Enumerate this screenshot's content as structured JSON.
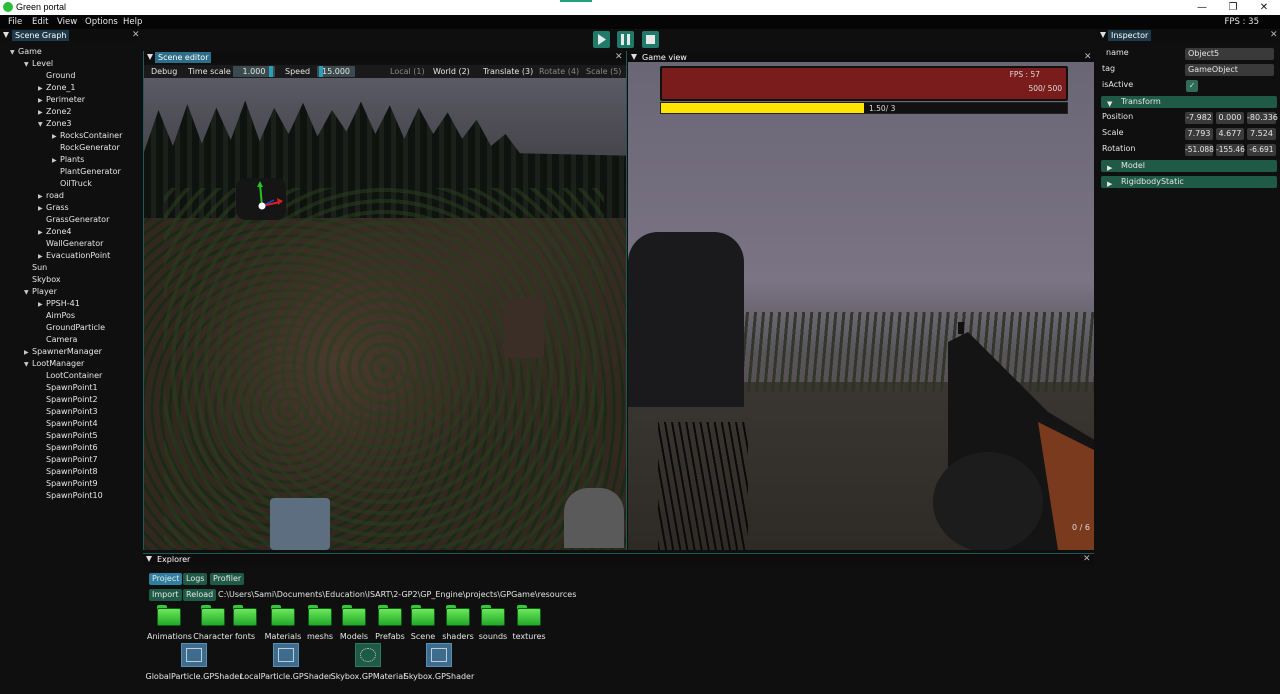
{
  "window": {
    "title": "Green portal",
    "minimize_glyph": "—",
    "restore_glyph": "❐",
    "close_glyph": "✕"
  },
  "menu": {
    "items": [
      "File",
      "Edit",
      "View",
      "Options",
      "Help"
    ],
    "fps": "FPS : 35"
  },
  "scene_graph": {
    "title": "Scene Graph",
    "close_glyph": "✕",
    "nodes": [
      {
        "label": "Game",
        "depth": 0,
        "arrow": "down"
      },
      {
        "label": "Level",
        "depth": 1,
        "arrow": "down"
      },
      {
        "label": "Ground",
        "depth": 2,
        "arrow": "none"
      },
      {
        "label": "Zone_1",
        "depth": 2,
        "arrow": "right"
      },
      {
        "label": "Perimeter",
        "depth": 2,
        "arrow": "right"
      },
      {
        "label": "Zone2",
        "depth": 2,
        "arrow": "right"
      },
      {
        "label": "Zone3",
        "depth": 2,
        "arrow": "down"
      },
      {
        "label": "RocksContainer",
        "depth": 3,
        "arrow": "right"
      },
      {
        "label": "RockGenerator",
        "depth": 3,
        "arrow": "none"
      },
      {
        "label": "Plants",
        "depth": 3,
        "arrow": "right"
      },
      {
        "label": "PlantGenerator",
        "depth": 3,
        "arrow": "none"
      },
      {
        "label": "OilTruck",
        "depth": 3,
        "arrow": "none"
      },
      {
        "label": "road",
        "depth": 2,
        "arrow": "right"
      },
      {
        "label": "Grass",
        "depth": 2,
        "arrow": "right"
      },
      {
        "label": "GrassGenerator",
        "depth": 2,
        "arrow": "none"
      },
      {
        "label": "Zone4",
        "depth": 2,
        "arrow": "right"
      },
      {
        "label": "WallGenerator",
        "depth": 2,
        "arrow": "none"
      },
      {
        "label": "EvacuationPoint",
        "depth": 2,
        "arrow": "right"
      },
      {
        "label": "Sun",
        "depth": 1,
        "arrow": "none"
      },
      {
        "label": "Skybox",
        "depth": 1,
        "arrow": "none"
      },
      {
        "label": "Player",
        "depth": 1,
        "arrow": "down"
      },
      {
        "label": "PPSH-41",
        "depth": 2,
        "arrow": "right"
      },
      {
        "label": "AimPos",
        "depth": 2,
        "arrow": "none"
      },
      {
        "label": "GroundParticle",
        "depth": 2,
        "arrow": "none"
      },
      {
        "label": "Camera",
        "depth": 2,
        "arrow": "none"
      },
      {
        "label": "SpawnerManager",
        "depth": 1,
        "arrow": "right"
      },
      {
        "label": "LootManager",
        "depth": 1,
        "arrow": "down"
      },
      {
        "label": "LootContainer",
        "depth": 2,
        "arrow": "none"
      },
      {
        "label": "SpawnPoint1",
        "depth": 2,
        "arrow": "none"
      },
      {
        "label": "SpawnPoint2",
        "depth": 2,
        "arrow": "none"
      },
      {
        "label": "SpawnPoint3",
        "depth": 2,
        "arrow": "none"
      },
      {
        "label": "SpawnPoint4",
        "depth": 2,
        "arrow": "none"
      },
      {
        "label": "SpawnPoint5",
        "depth": 2,
        "arrow": "none"
      },
      {
        "label": "SpawnPoint6",
        "depth": 2,
        "arrow": "none"
      },
      {
        "label": "SpawnPoint7",
        "depth": 2,
        "arrow": "none"
      },
      {
        "label": "SpawnPoint8",
        "depth": 2,
        "arrow": "none"
      },
      {
        "label": "SpawnPoint9",
        "depth": 2,
        "arrow": "none"
      },
      {
        "label": "SpawnPoint10",
        "depth": 2,
        "arrow": "none"
      }
    ]
  },
  "scene_editor": {
    "title": "Scene editor",
    "close_glyph": "✕",
    "debug": "Debug",
    "time_scale_label": "Time scale",
    "time_scale_value": "1.000",
    "speed_label": "Speed",
    "speed_value": "15.000",
    "local": "Local (1)",
    "world": "World (2)",
    "translate": "Translate (3)",
    "rotate": "Rotate (4)",
    "scale": "Scale (5)"
  },
  "game_view": {
    "title": "Game view",
    "close_glyph": "✕",
    "fps": "FPS : 57",
    "health": "500/ 500",
    "stamina": "1.50/ 3",
    "stamina_fraction": 0.5,
    "ammo": "0 / 6"
  },
  "inspector": {
    "title": "Inspector",
    "close_glyph": "✕",
    "name_label": "name",
    "name_value": "Object5",
    "tag_label": "tag",
    "tag_value": "GameObject",
    "active_label": "isActive",
    "check_glyph": "✓",
    "transform_label": "Transform",
    "position_label": "Position",
    "position": [
      "-7.982",
      "0.000",
      "-80.336"
    ],
    "scale_label": "Scale",
    "scale": [
      "7.793",
      "4.677",
      "7.524"
    ],
    "rotation_label": "Rotation",
    "rotation": [
      "-51.088",
      "-155.46",
      "-6.691"
    ],
    "model_label": "Model",
    "rigidbody_label": "RigidbodyStatic"
  },
  "explorer": {
    "title": "Explorer",
    "close_glyph": "✕",
    "tabs": [
      "Project",
      "Logs",
      "Profiler"
    ],
    "import": "Import",
    "reload": "Reload",
    "path": "C:\\Users\\Sami\\Documents\\Education\\ISART\\2-GP2\\GP_Engine\\projects\\GPGame\\resources",
    "folders": [
      "Animations",
      "Character",
      "fonts",
      "Materials",
      "meshs",
      "Models",
      "Prefabs",
      "Scene",
      "shaders",
      "sounds",
      "textures"
    ],
    "files": [
      "GlobalParticle.GPShader",
      "LocalParticle.GPShader",
      "Skybox.GPMaterial",
      "Skybox.GPShader"
    ]
  },
  "colors": {
    "accent": "#2e6e89",
    "section": "#1f5a46",
    "health": "#7a1c1c",
    "stamina": "#ffe500",
    "folder": "#37c53b"
  }
}
